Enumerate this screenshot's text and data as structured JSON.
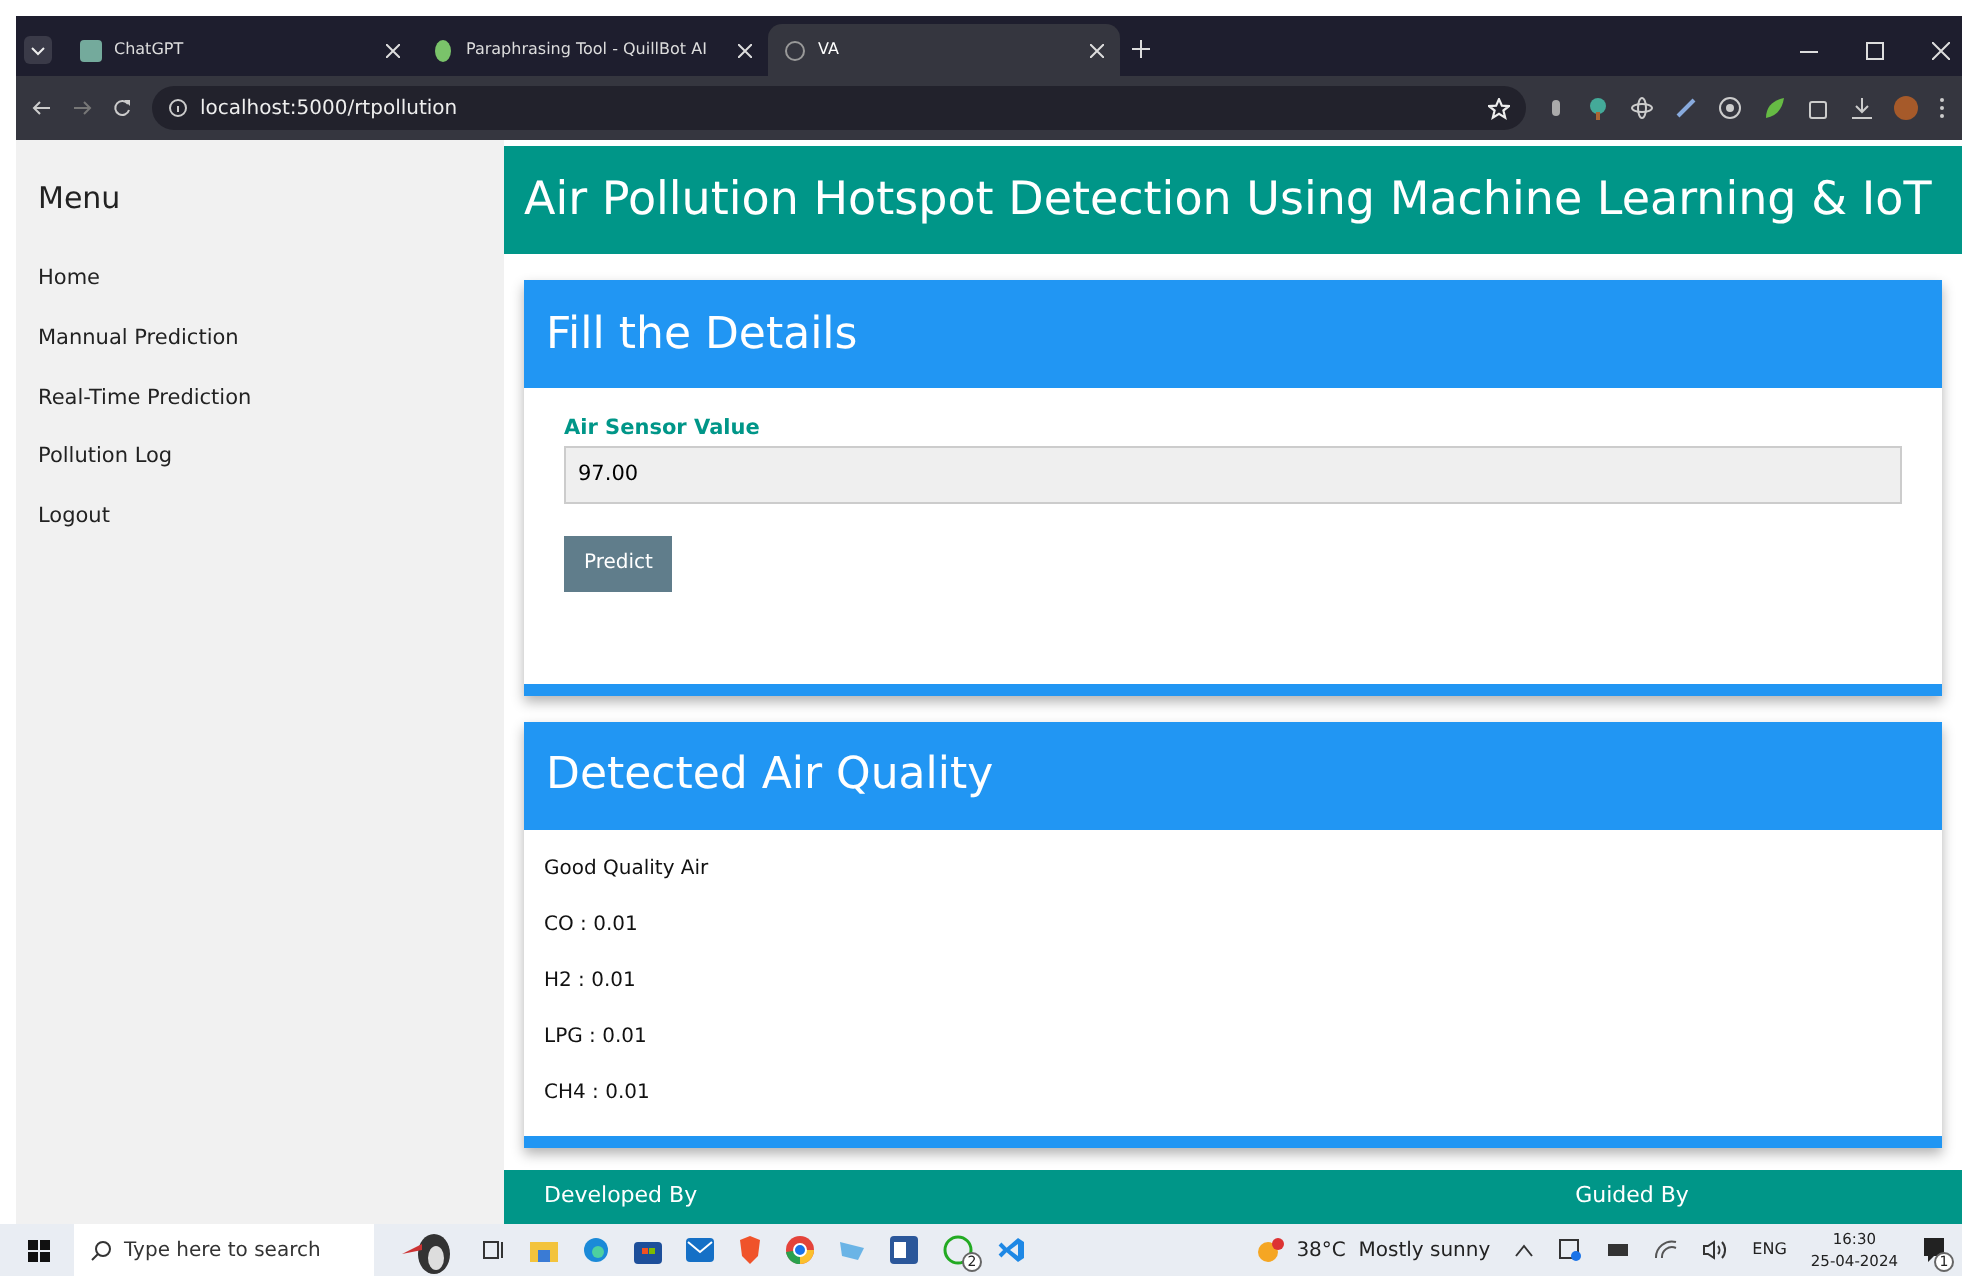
{
  "browser": {
    "tabs": [
      {
        "title": "ChatGPT",
        "selected": false
      },
      {
        "title": "Paraphrasing Tool - QuillBot AI",
        "selected": false
      },
      {
        "title": "VA",
        "selected": true
      }
    ],
    "url": "localhost:5000/rtpollution"
  },
  "sidebar": {
    "title": "Menu",
    "items": [
      {
        "label": "Home"
      },
      {
        "label": "Mannual Prediction"
      },
      {
        "label": "Real-Time Prediction"
      },
      {
        "label": "Pollution Log"
      },
      {
        "label": "Logout"
      }
    ]
  },
  "header": {
    "title": "Air Pollution Hotspot Detection Using Machine Learning & IoT"
  },
  "form_card": {
    "title": "Fill the Details",
    "field_label": "Air Sensor Value",
    "field_value": "97.00",
    "button": "Predict"
  },
  "result_card": {
    "title": "Detected Air Quality",
    "lines": [
      "Good Quality Air",
      "CO : 0.01",
      "H2 : 0.01",
      "LPG : 0.01",
      "CH4 : 0.01"
    ]
  },
  "footer": {
    "left": "Developed By",
    "right": "Guided By"
  },
  "taskbar": {
    "search_placeholder": "Type here to search",
    "whatsapp_badge": "2",
    "weather": "38°C  Mostly sunny",
    "language": "ENG",
    "time": "16:30",
    "date": "25-04-2024",
    "notification_badge": "1"
  }
}
